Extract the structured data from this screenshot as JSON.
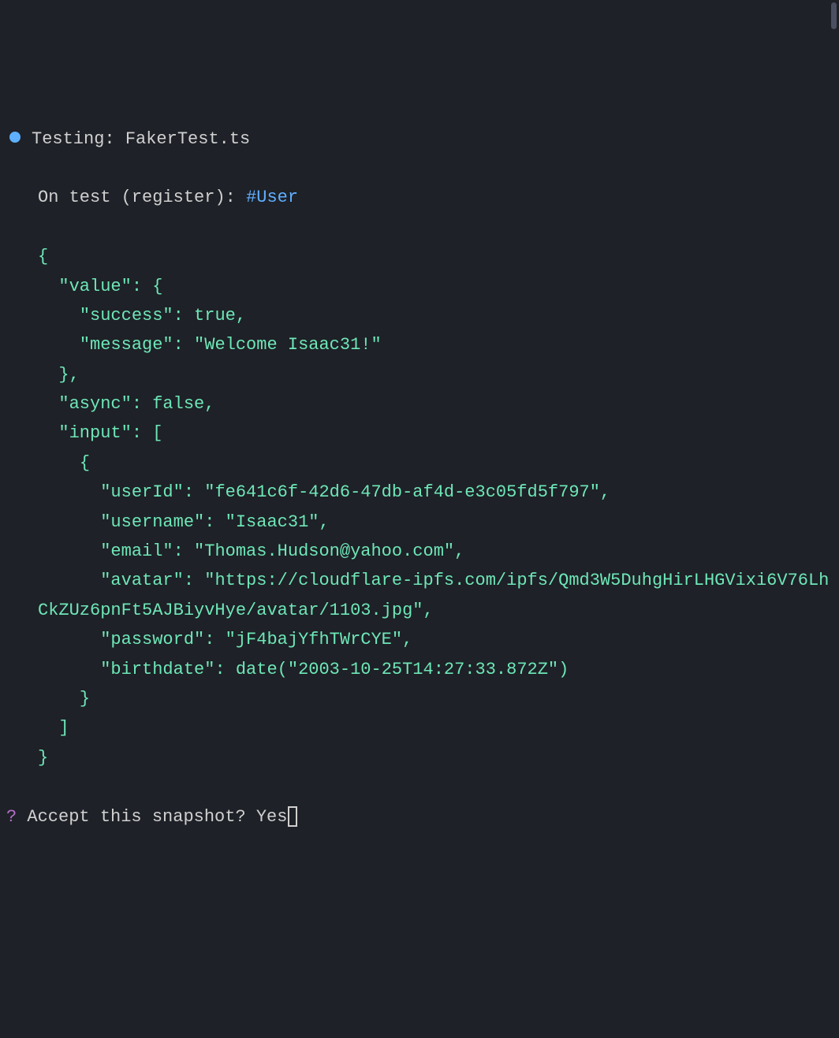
{
  "header": {
    "testing_label": "Testing:",
    "file": "FakerTest.ts",
    "on_test_prefix": "On test",
    "on_test_paren": "(register):",
    "tag": "#User"
  },
  "json": {
    "open": "{",
    "value_key": "\"value\"",
    "value_open": ": {",
    "success_key": "\"success\"",
    "success_val": ": true,",
    "message_key": "\"message\"",
    "message_val": ": \"Welcome Isaac31!\"",
    "value_close": "},",
    "async_key": "\"async\"",
    "async_val": ": false,",
    "input_key": "\"input\"",
    "input_open": ": [",
    "obj_open": "{",
    "userId_key": "\"userId\"",
    "userId_val": ": \"fe641c6f-42d6-47db-af4d-e3c05fd5f797\",",
    "username_key": "\"username\"",
    "username_val": ": \"Isaac31\",",
    "email_key": "\"email\"",
    "email_val": ": \"Thomas.Hudson@yahoo.com\",",
    "avatar_key": "\"avatar\"",
    "avatar_val": ": \"https://cloudflare-ipfs.com/ipfs/Qmd3W5DuhgHirLHGVixi6V76LhCkZUz6pnFt5AJBiyvHye/avatar/1103.jpg\",",
    "password_key": "\"password\"",
    "password_val": ": \"jF4bajYfhTWrCYE\",",
    "birthdate_key": "\"birthdate\"",
    "birthdate_val": ": date(\"2003-10-25T14:27:33.872Z\")",
    "obj_close": "}",
    "input_close": "]",
    "close": "}"
  },
  "prompt": {
    "question_mark": "?",
    "text": "Accept this snapshot?",
    "answer": "Yes"
  }
}
